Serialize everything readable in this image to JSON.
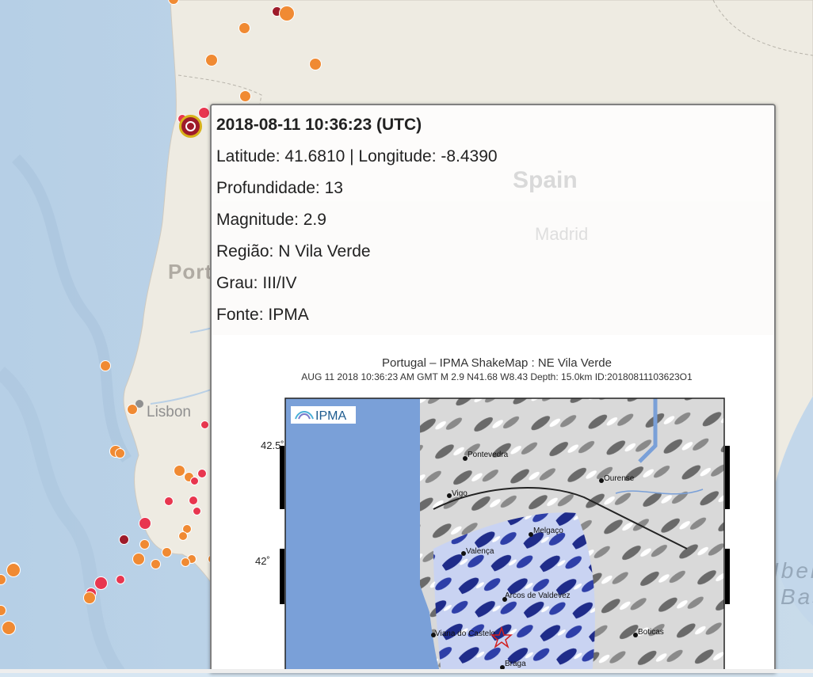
{
  "map": {
    "labels": {
      "portugal": "Portugal",
      "spain": "Spain",
      "madrid": "Madrid",
      "lisbon": "Lisbon",
      "iberia": "Iberia",
      "basin": "Basin"
    },
    "colors": {
      "ocean": "#bcd3e8",
      "land": "#f0ede5",
      "quake_orange": "#f08a33",
      "quake_red": "#e8364f",
      "quake_darkred": "#9e1b2a",
      "selected_ring": "#d8b21a"
    }
  },
  "popup": {
    "title": "2018-08-11 10:36:23 (UTC)",
    "coords": "Latitude: 41.6810 | Longitude: -8.4390",
    "depth": "Profundidade: 13",
    "magnitude": "Magnitude: 2.9",
    "region": "Região: N Vila Verde",
    "grade": "Grau: III/IV",
    "source": "Fonte: IPMA"
  },
  "shakemap": {
    "title": "Portugal – IPMA ShakeMap : NE Vila Verde",
    "subtitle": "AUG 11 2018 10:36:23 AM GMT   M 2.9   N41.68 W8.43   Depth: 15.0km   ID:20180811103623O1",
    "logo": "IPMA",
    "lat_ticks": [
      "42.5˚",
      "42˚"
    ],
    "places": {
      "pontevedra": "Pontevedra",
      "ourense": "Ourense",
      "vigo": "Vigo",
      "melgaco": "Melgaço",
      "valenca": "Valença",
      "arcos": "Arcos de Valdevez",
      "viana": "Viana do Castelo",
      "boticas": "Boticas",
      "braga": "Braga"
    }
  }
}
